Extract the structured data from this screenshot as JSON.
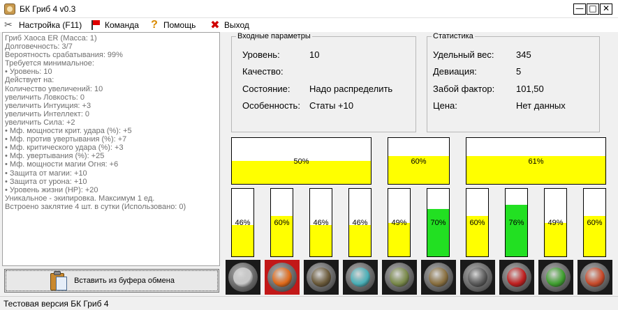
{
  "window": {
    "title": "БК Гриб 4 v0.3",
    "controls": {
      "minimize": "—",
      "maximize": "□",
      "close": "✕"
    }
  },
  "menu": [
    {
      "label": "Настройка (F11)",
      "icon": "wrench-icon"
    },
    {
      "label": "Команда",
      "icon": "flag-icon"
    },
    {
      "label": "Помощь",
      "icon": "help-icon"
    },
    {
      "label": "Выход",
      "icon": "exit-icon"
    }
  ],
  "info_lines": [
    "Гриб Хаоса ER (Масса: 1)",
    "Долговечность: 3/7",
    "Вероятность срабатывания: 99%",
    "Требуется минимальное:",
    "• Уровень: 10",
    "Действует на:",
    "Количество увеличений: 10",
    "увеличить Ловкость: 0",
    "увеличить Интуиция: +3",
    "увеличить Интеллект: 0",
    "увеличить Сила: +2",
    "• Мф. мощности крит. удара (%): +5",
    "• Мф. против увертывания (%): +7",
    "• Мф. критического удара (%): +3",
    "• Мф. увертывания (%): +25",
    "• Мф. мощности магии Огня: +6",
    "• Защита от магии: +10",
    "• Защита от урона: +10",
    "• Уровень жизни (HP): +20",
    "Уникальное - экипировка. Максимум 1 ед.",
    "Встроено заклятие 4 шт. в сутки (Использовано: 0)"
  ],
  "paste_button": {
    "label": "Вставить из буфера обмена"
  },
  "input_params": {
    "title": "Входные параметры",
    "rows": [
      {
        "label": "Уровень:",
        "value": "10"
      },
      {
        "label": "Качество:",
        "value": ""
      },
      {
        "label": "Состояние:",
        "value": "Надо распределить"
      },
      {
        "label": "Особенность:",
        "value": "Статы +10"
      }
    ]
  },
  "statistics": {
    "title": "Статистика",
    "rows": [
      {
        "label": "Удельный вес:",
        "value": "345"
      },
      {
        "label": "Девиация:",
        "value": "5"
      },
      {
        "label": "Забой фактор:",
        "value": "101,50"
      },
      {
        "label": "Цена:",
        "value": "Нет данных"
      }
    ]
  },
  "colors": {
    "yellow": "#ffff00",
    "green": "#22e022",
    "selected": "#c21818"
  },
  "top_bars": [
    {
      "label": "50%",
      "value": 0.5,
      "color": "yellow"
    },
    {
      "label": "60%",
      "value": 0.6,
      "color": "yellow"
    },
    {
      "label": "61%",
      "value": 0.61,
      "color": "yellow"
    }
  ],
  "small_bars": [
    {
      "label": "46%",
      "value": 0.46,
      "color": "yellow"
    },
    {
      "label": "60%",
      "value": 0.6,
      "color": "yellow"
    },
    {
      "label": "46%",
      "value": 0.46,
      "color": "yellow"
    },
    {
      "label": "46%",
      "value": 0.46,
      "color": "yellow"
    },
    {
      "label": "49%",
      "value": 0.49,
      "color": "yellow"
    },
    {
      "label": "70%",
      "value": 0.7,
      "color": "green"
    },
    {
      "label": "60%",
      "value": 0.6,
      "color": "yellow"
    },
    {
      "label": "76%",
      "value": 0.76,
      "color": "green"
    },
    {
      "label": "49%",
      "value": 0.49,
      "color": "yellow"
    },
    {
      "label": "60%",
      "value": 0.6,
      "color": "yellow"
    }
  ],
  "item_icons": [
    {
      "name": "gray-mushroom-icon",
      "color": "#c8c8c8",
      "selected": false
    },
    {
      "name": "fire-mushroom-icon",
      "color": "#e06a1a",
      "selected": true
    },
    {
      "name": "earth-mushroom-icon",
      "color": "#6b5a3a",
      "selected": false
    },
    {
      "name": "water-mushroom-icon",
      "color": "#4ab0b8",
      "selected": false
    },
    {
      "name": "forest-mushroom-icon",
      "color": "#7a8a4a",
      "selected": false
    },
    {
      "name": "wood-mushroom-icon",
      "color": "#8a7040",
      "selected": false
    },
    {
      "name": "stone-mushroom-icon",
      "color": "#5a5a5a",
      "selected": false
    },
    {
      "name": "blood-mushroom-icon",
      "color": "#c02020",
      "selected": false
    },
    {
      "name": "green-mushroom-icon",
      "color": "#40a030",
      "selected": false
    },
    {
      "name": "amber-mushroom-icon",
      "color": "#c84a2a",
      "selected": false
    }
  ]
}
